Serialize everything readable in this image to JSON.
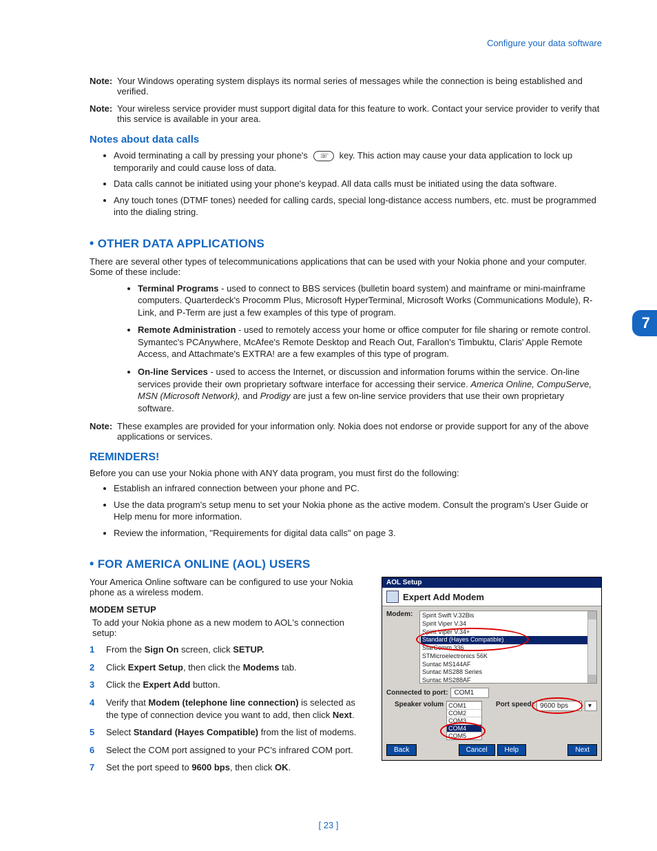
{
  "header": {
    "breadcrumb": "Configure your data software"
  },
  "sideTab": "7",
  "notes": [
    {
      "label": "Note:",
      "text": "Your Windows operating system displays its normal series of messages while the connection is being established and verified."
    },
    {
      "label": "Note:",
      "text": "Your wireless service provider must support digital data for this feature to work. Contact your service provider to verify that this service is available in your area."
    }
  ],
  "section_notes_about": {
    "title": "Notes about data calls",
    "bullets": [
      {
        "pre": "Avoid terminating a call by pressing your phone's ",
        "post": " key. This action may cause your data application to lock up temporarily and could cause loss of data.",
        "icon": true
      },
      {
        "text": "Data calls cannot be initiated using your phone's keypad. All data calls must be initiated using the data software."
      },
      {
        "text": "Any touch tones (DTMF tones) needed for calling cards, special long-distance access numbers, etc. must be programmed into the dialing string."
      }
    ]
  },
  "section_other": {
    "title": "OTHER DATA APPLICATIONS",
    "intro": "There are several other types of telecommunications applications that can be used with your Nokia phone and your computer. Some of these include:",
    "items": [
      {
        "bold": "Terminal Programs",
        "text": " - used to connect to BBS services (bulletin board system) and mainframe or mini-mainframe computers. Quarterdeck's Procomm Plus, Microsoft HyperTerminal, Microsoft Works (Communications Module), R-Link, and P-Term are just a few examples of this type of program."
      },
      {
        "bold": "Remote Administration",
        "text": " - used to remotely access your home or office computer for file sharing or remote control. Symantec's PCAnywhere, McAfee's Remote Desktop and Reach Out, Farallon's Timbuktu, Claris' Apple Remote Access, and Attachmate's EXTRA! are a few examples of this type of program."
      },
      {
        "bold": "On-line Services",
        "text_pre": " - used to access the Internet, or discussion and information forums within the service. On-line services provide their own proprietary software interface for accessing their service. ",
        "italics": "America Online, CompuServe, MSN (Microsoft Network),",
        "text_mid": " and ",
        "italics2": "Prodigy",
        "text_post": " are just a few on-line service providers that use their own proprietary software."
      }
    ],
    "note": {
      "label": "Note:",
      "text": "These examples are provided for your information only. Nokia does not endorse or provide support for any of the above applications or services."
    }
  },
  "section_reminders": {
    "title": "REMINDERS!",
    "intro": "Before you can use your Nokia phone with ANY data program, you must first do the following:",
    "bullets": [
      "Establish an infrared connection between your phone and PC.",
      "Use the data program's setup menu to set your Nokia phone as the active modem. Consult the program's User Guide or Help menu for more information.",
      "Review the information, \"Requirements for digital data calls\" on page 3."
    ]
  },
  "section_aol": {
    "title": "FOR AMERICA ONLINE (AOL) USERS",
    "intro": "Your America Online software can be configured to use your Nokia phone as a wireless modem.",
    "sub": "MODEM SETUP",
    "sub_intro": "To add your Nokia phone as a new modem to AOL's connection setup:",
    "steps": [
      [
        {
          "t": "From the "
        },
        {
          "b": "Sign On"
        },
        {
          "t": " screen, click "
        },
        {
          "b": "SETUP."
        }
      ],
      [
        {
          "t": "Click "
        },
        {
          "b": "Expert Setup"
        },
        {
          "t": ", then click the "
        },
        {
          "b": "Modems"
        },
        {
          "t": " tab."
        }
      ],
      [
        {
          "t": "Click the "
        },
        {
          "b": "Expert Add"
        },
        {
          "t": " button."
        }
      ],
      [
        {
          "t": "Verify that "
        },
        {
          "b": "Modem (telephone line connection)"
        },
        {
          "t": " is selected as the type of connection device you want to add, then click "
        },
        {
          "b": "Next"
        },
        {
          "t": "."
        }
      ],
      [
        {
          "t": "Select "
        },
        {
          "b": "Standard (Hayes Compatible)"
        },
        {
          "t": " from the list of modems."
        }
      ],
      [
        {
          "t": "Select the COM port assigned to your PC's infrared COM port."
        }
      ],
      [
        {
          "t": "Set the port speed to "
        },
        {
          "b": "9600 bps"
        },
        {
          "t": ", then click "
        },
        {
          "b": "OK"
        },
        {
          "t": "."
        }
      ]
    ]
  },
  "aol_dialog": {
    "title": "AOL Setup",
    "header": "Expert Add Modem",
    "modem_label": "Modem:",
    "modems": [
      "Spirit Swift V.32Bis",
      "Spirit Viper V.34",
      "Spirit Viper V.34+",
      "Standard (Hayes Compatible)",
      "StarComm 336",
      "STMicroelectronics 56K",
      "Suntac MS144AF",
      "Suntac MS288 Series",
      "Suntac MS288AF"
    ],
    "modem_selected_index": 3,
    "connected_label": "Connected to port:",
    "port_value": "COM1",
    "com_options": [
      "COM1",
      "COM2",
      "COM3",
      "COM4",
      "COM5"
    ],
    "com_selected_index": 3,
    "speaker_label": "Speaker volum",
    "port_speed_label": "Port speed:",
    "port_speed_value": "9600 bps",
    "buttons": {
      "back": "Back",
      "cancel": "Cancel",
      "help": "Help",
      "next": "Next"
    }
  },
  "pageNumber": "[ 23 ]"
}
